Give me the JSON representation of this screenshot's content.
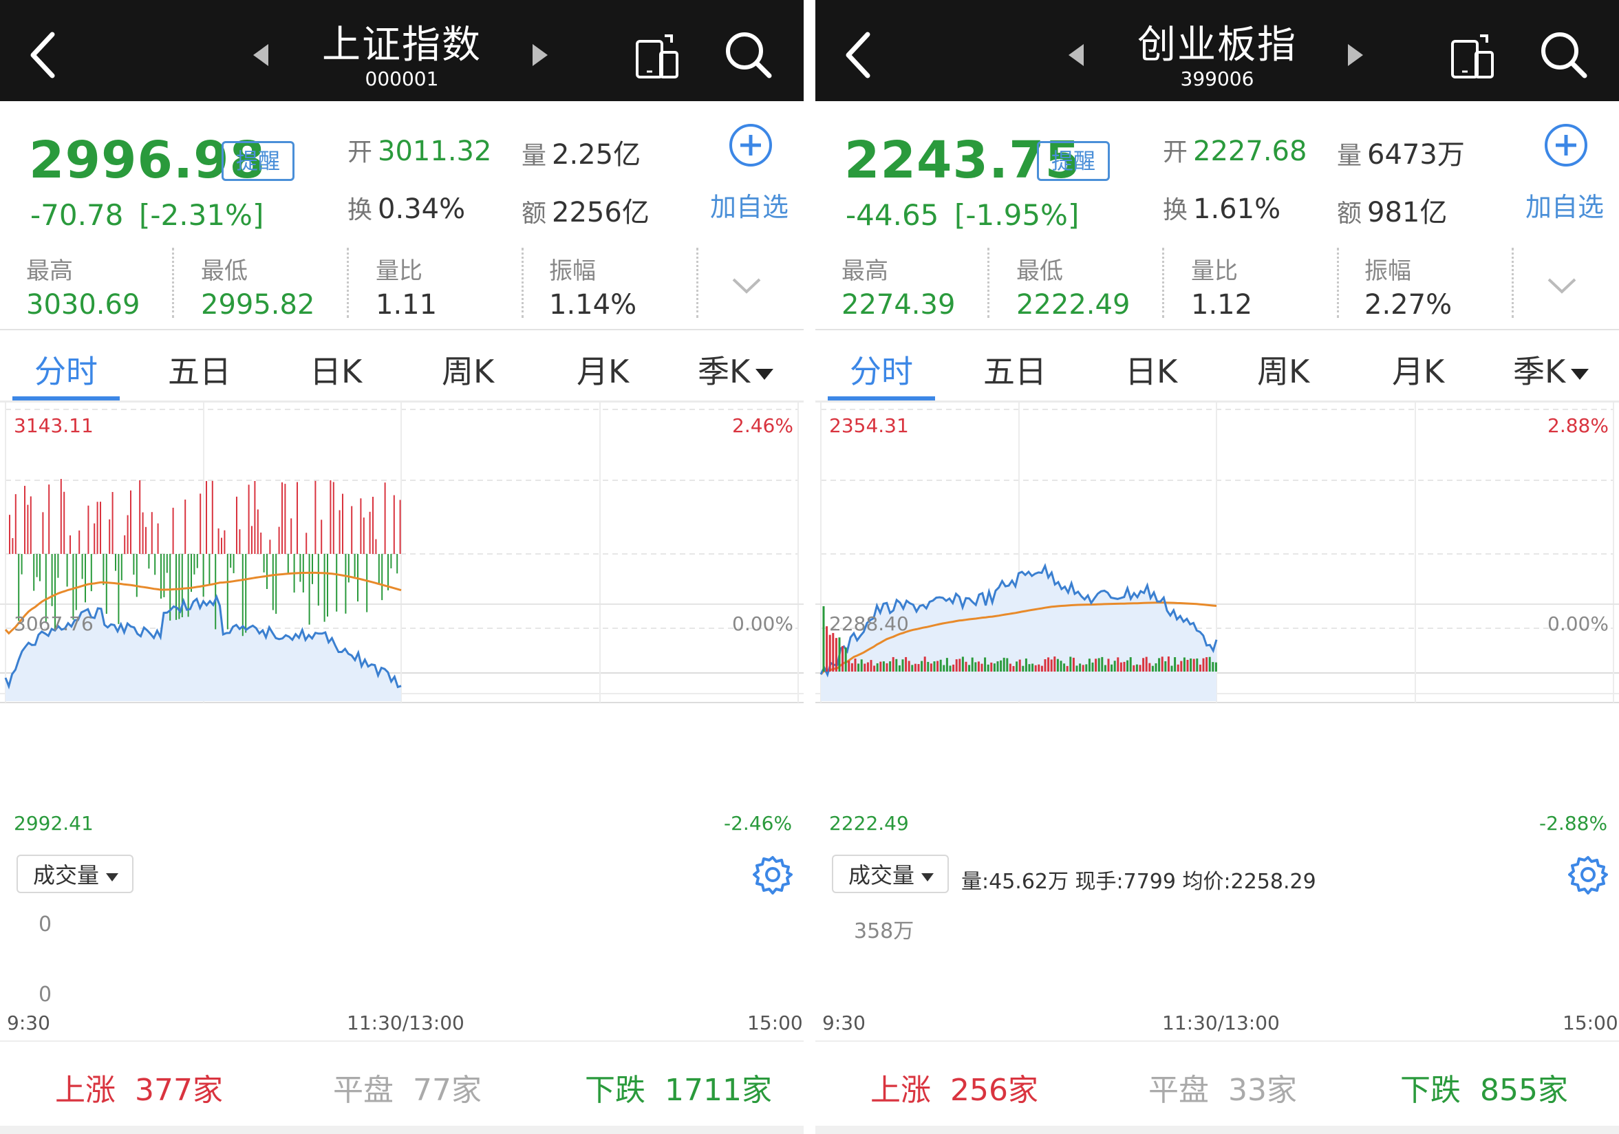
{
  "panels": [
    {
      "name": "上证指数",
      "code": "000001",
      "price": "2996.98",
      "remind_label": "提醒",
      "change": "-70.78",
      "change_pct": "[-2.31%]",
      "open_label": "开",
      "open": "3011.32",
      "volume_label": "量",
      "volume": "2.25亿",
      "turnover_label": "换",
      "turnover": "0.34%",
      "amount_label": "额",
      "amount": "2256亿",
      "add_label": "加自选",
      "stats": [
        {
          "label": "最高",
          "value": "3030.69",
          "color": "green"
        },
        {
          "label": "最低",
          "value": "2995.82",
          "color": "green"
        },
        {
          "label": "量比",
          "value": "1.11",
          "color": "dark"
        },
        {
          "label": "振幅",
          "value": "1.14%",
          "color": "dark"
        }
      ],
      "tabs": [
        "分时",
        "五日",
        "日K",
        "周K",
        "月K",
        "季K"
      ],
      "active_tab": "分时",
      "axis": {
        "top_left": "3143.11",
        "top_right": "2.46%",
        "mid_left": "3067.76",
        "mid_right": "0.00%",
        "bottom_left": "2992.41",
        "bottom_right": "-2.46%"
      },
      "volume_selector": "成交量",
      "volume_info": "",
      "volume_axis": [
        "0",
        "0"
      ],
      "time_labels": [
        "9:30",
        "11:30/13:00",
        "15:00"
      ],
      "footer": {
        "up_label": "上涨",
        "up": "377家",
        "flat_label": "平盘",
        "flat": "77家",
        "down_label": "下跌",
        "down": "1711家"
      }
    },
    {
      "name": "创业板指",
      "code": "399006",
      "price": "2243.75",
      "remind_label": "提醒",
      "change": "-44.65",
      "change_pct": "[-1.95%]",
      "open_label": "开",
      "open": "2227.68",
      "volume_label": "量",
      "volume": "6473万",
      "turnover_label": "换",
      "turnover": "1.61%",
      "amount_label": "额",
      "amount": "981亿",
      "add_label": "加自选",
      "stats": [
        {
          "label": "最高",
          "value": "2274.39",
          "color": "green"
        },
        {
          "label": "最低",
          "value": "2222.49",
          "color": "green"
        },
        {
          "label": "量比",
          "value": "1.12",
          "color": "dark"
        },
        {
          "label": "振幅",
          "value": "2.27%",
          "color": "dark"
        }
      ],
      "tabs": [
        "分时",
        "五日",
        "日K",
        "周K",
        "月K",
        "季K"
      ],
      "active_tab": "分时",
      "axis": {
        "top_left": "2354.31",
        "top_right": "2.88%",
        "mid_left": "2288.40",
        "mid_right": "0.00%",
        "bottom_left": "2222.49",
        "bottom_right": "-2.88%"
      },
      "volume_selector": "成交量",
      "volume_info": "量:45.62万  现手:7799  均价:2258.29",
      "volume_axis": [
        "358万"
      ],
      "time_labels": [
        "9:30",
        "11:30/13:00",
        "15:00"
      ],
      "footer": {
        "up_label": "上涨",
        "up": "256家",
        "flat_label": "平盘",
        "flat": "33家",
        "down_label": "下跌",
        "down": "855家"
      }
    }
  ],
  "colors": {
    "up_red": "#d9343f",
    "down_green": "#2a9a3c",
    "accent_blue": "#3c87e6",
    "price_line": "#3a7fd0",
    "avg_line": "#e88a2a",
    "area_fill": "#e4eefb",
    "topbar": "#151515"
  },
  "icons": [
    "back-arrow-icon",
    "prev-triangle-icon",
    "next-triangle-icon",
    "rotate-phone-icon",
    "search-icon",
    "add-circle-icon",
    "chevron-down-icon",
    "dropdown-triangle-icon",
    "gear-icon"
  ]
}
